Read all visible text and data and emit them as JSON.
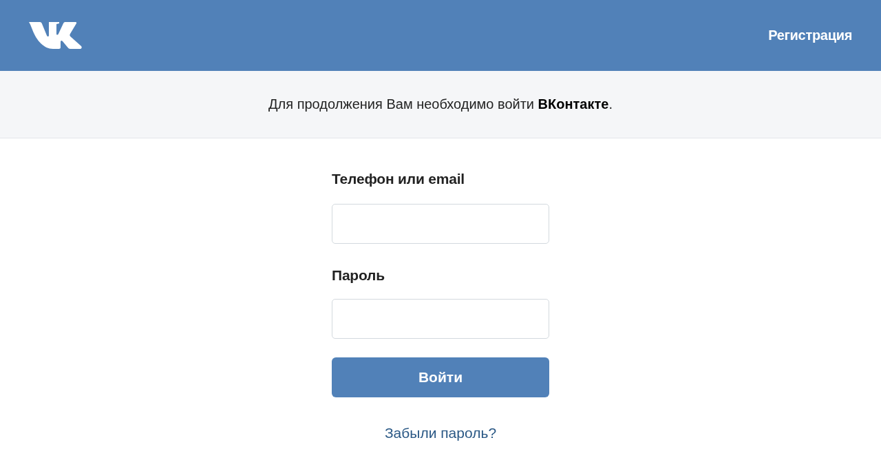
{
  "header": {
    "register_link": "Регистрация"
  },
  "notice": {
    "text": "Для продолжения Вам необходимо войти **ВКонтакте**."
  },
  "form": {
    "fields": [
      {
        "label": "Телефон или email"
      },
      {
        "label": "Пароль"
      }
    ],
    "submit": "Войти",
    "forgot_link": "Забыли пароль?"
  }
}
